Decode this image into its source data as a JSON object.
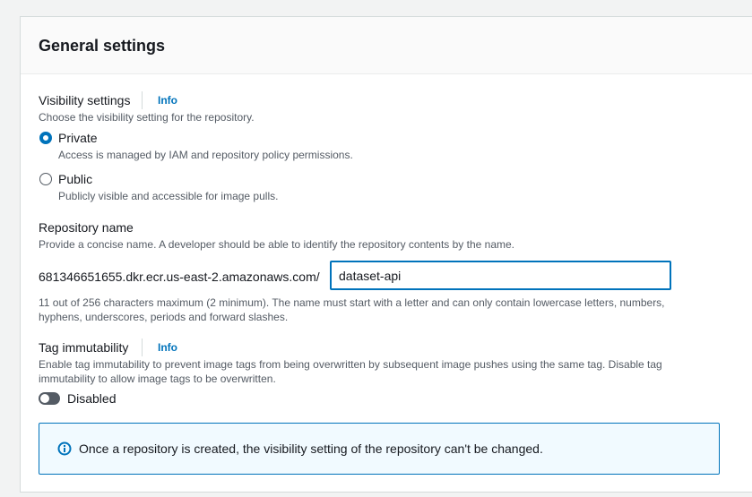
{
  "panel": {
    "title": "General settings"
  },
  "visibility": {
    "label": "Visibility settings",
    "info_link": "Info",
    "description": "Choose the visibility setting for the repository.",
    "options": [
      {
        "label": "Private",
        "description": "Access is managed by IAM and repository policy permissions.",
        "selected": true
      },
      {
        "label": "Public",
        "description": "Publicly visible and accessible for image pulls.",
        "selected": false
      }
    ]
  },
  "repository_name": {
    "label": "Repository name",
    "description": "Provide a concise name. A developer should be able to identify the repository contents by the name.",
    "prefix": "681346651655.dkr.ecr.us-east-2.amazonaws.com/",
    "value": "dataset-api",
    "constraint_line1": "11 out of 256 characters maximum (2 minimum). The name must start with a letter and can only contain lowercase letters, numbers,",
    "constraint_line2": "hyphens, underscores, periods and forward slashes."
  },
  "tag_immutability": {
    "label": "Tag immutability",
    "info_link": "Info",
    "description_line1": "Enable tag immutability to prevent image tags from being overwritten by subsequent image pushes using the same tag. Disable tag",
    "description_line2": "immutability to allow image tags to be overwritten.",
    "toggle_label": "Disabled",
    "enabled": false
  },
  "alert": {
    "icon": "info-circle-icon",
    "message": "Once a repository is created, the visibility setting of the repository can't be changed."
  },
  "colors": {
    "accent": "#0073bb",
    "text": "#16191f",
    "secondary_text": "#545b64",
    "alert_background": "#f1faff"
  }
}
